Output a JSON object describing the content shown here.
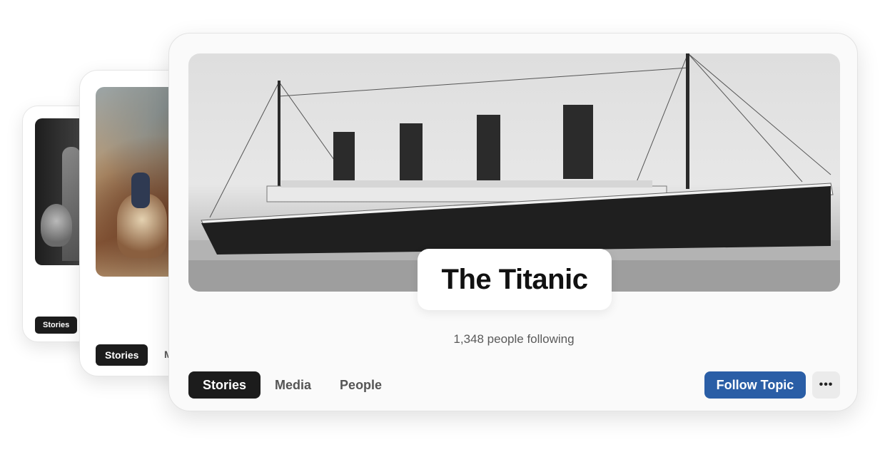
{
  "back_card": {
    "tag_label": "Stories"
  },
  "middle_card": {
    "tag_label": "Stories",
    "second_tab_partial": "M"
  },
  "topic": {
    "title": "The Titanic",
    "followers_text": "1,348 people following"
  },
  "tabs": [
    {
      "label": "Stories",
      "active": true
    },
    {
      "label": "Media",
      "active": false
    },
    {
      "label": "People",
      "active": false
    }
  ],
  "actions": {
    "follow_label": "Follow Topic",
    "more_label": "•••"
  },
  "colors": {
    "follow_button": "#2a5ea6",
    "active_tab": "#1c1c1c"
  },
  "icons": [
    "more-horizontal-icon"
  ]
}
